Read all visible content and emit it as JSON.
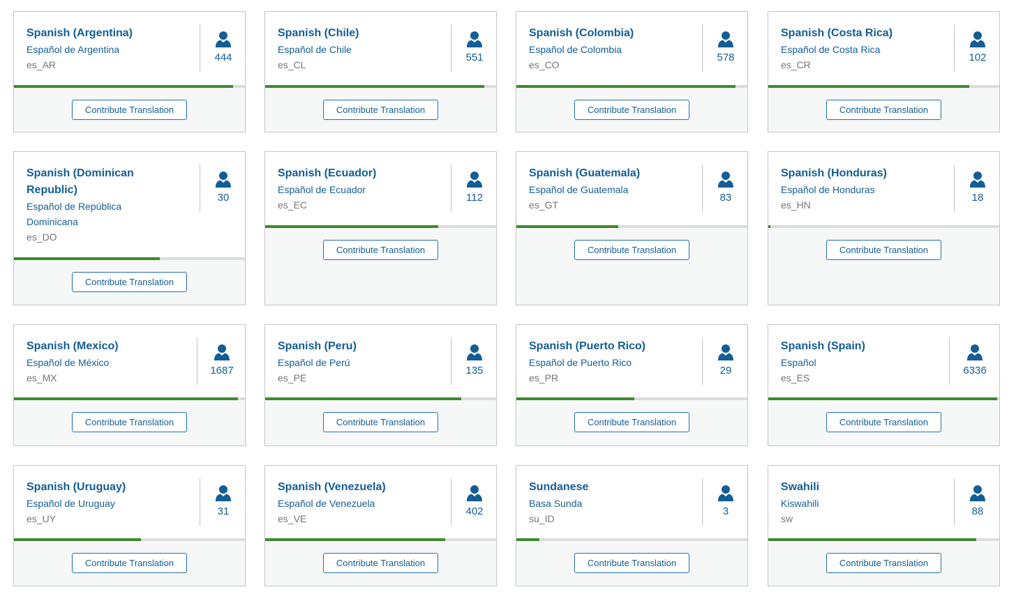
{
  "button_label": "Contribute Translation",
  "colors": {
    "accent": "#135e96",
    "progress": "#3c8a2e",
    "track": "#dcdcde",
    "border": "#c3c4c7"
  },
  "icon": "person-icon",
  "locales": [
    {
      "name": "Spanish (Argentina)",
      "native": "Español de Argentina",
      "code": "es_AR",
      "contributors": "444",
      "progress": 0.95
    },
    {
      "name": "Spanish (Chile)",
      "native": "Español de Chile",
      "code": "es_CL",
      "contributors": "551",
      "progress": 0.95
    },
    {
      "name": "Spanish (Colombia)",
      "native": "Español de Colombia",
      "code": "es_CO",
      "contributors": "578",
      "progress": 0.95
    },
    {
      "name": "Spanish (Costa Rica)",
      "native": "Español de Costa Rica",
      "code": "es_CR",
      "contributors": "102",
      "progress": 0.87
    },
    {
      "name": "Spanish (Dominican Republic)",
      "native": "Español de República Dominicana",
      "code": "es_DO",
      "contributors": "30",
      "progress": 0.63
    },
    {
      "name": "Spanish (Ecuador)",
      "native": "Español de Ecuador",
      "code": "es_EC",
      "contributors": "112",
      "progress": 0.75
    },
    {
      "name": "Spanish (Guatemala)",
      "native": "Español de Guatemala",
      "code": "es_GT",
      "contributors": "83",
      "progress": 0.44
    },
    {
      "name": "Spanish (Honduras)",
      "native": "Español de Honduras",
      "code": "es_HN",
      "contributors": "18",
      "progress": 0.01
    },
    {
      "name": "Spanish (Mexico)",
      "native": "Español de México",
      "code": "es_MX",
      "contributors": "1687",
      "progress": 0.97
    },
    {
      "name": "Spanish (Peru)",
      "native": "Español de Perú",
      "code": "es_PE",
      "contributors": "135",
      "progress": 0.85
    },
    {
      "name": "Spanish (Puerto Rico)",
      "native": "Español de Puerto Rico",
      "code": "es_PR",
      "contributors": "29",
      "progress": 0.51
    },
    {
      "name": "Spanish (Spain)",
      "native": "Español",
      "code": "es_ES",
      "contributors": "6336",
      "progress": 0.99
    },
    {
      "name": "Spanish (Uruguay)",
      "native": "Español de Uruguay",
      "code": "es_UY",
      "contributors": "31",
      "progress": 0.55
    },
    {
      "name": "Spanish (Venezuela)",
      "native": "Español de Venezuela",
      "code": "es_VE",
      "contributors": "402",
      "progress": 0.78
    },
    {
      "name": "Sundanese",
      "native": "Basa Sunda",
      "code": "su_ID",
      "contributors": "3",
      "progress": 0.1
    },
    {
      "name": "Swahili",
      "native": "Kiswahili",
      "code": "sw",
      "contributors": "88",
      "progress": 0.9
    }
  ]
}
